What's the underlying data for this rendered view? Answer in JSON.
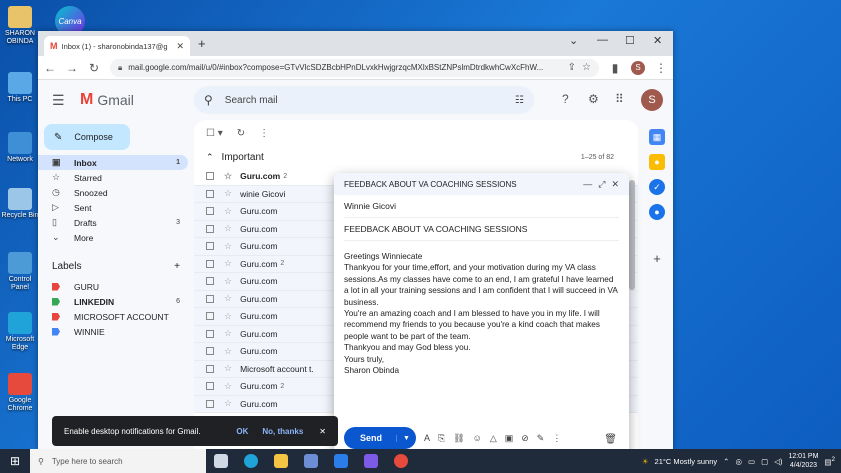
{
  "desktop": {
    "icons": [
      {
        "label": "SHARON OBINDA",
        "color": "#e8c36a"
      },
      {
        "label": "This PC",
        "color": "#5aa9e6"
      },
      {
        "label": "Network",
        "color": "#3f8fd6"
      },
      {
        "label": "Recycle Bin",
        "color": "#9cc6e8"
      },
      {
        "label": "Control Panel",
        "color": "#4c9ad6"
      },
      {
        "label": "Microsoft Edge",
        "color": "#1fa3d8"
      },
      {
        "label": "Google Chrome",
        "color": "#e64a3c"
      }
    ],
    "canva_label": "Canva"
  },
  "browser": {
    "tab_title": "Inbox (1) - sharonobinda137@g",
    "url": "mail.google.com/mail/u/0/#inbox?compose=GTvVlcSDZBcbHPnDLvxkHwjgrzqcMXlxBStZNPslmDtrdkwhCwXcFhW...",
    "profile_initial": "S"
  },
  "gmail": {
    "brand": "Gmail",
    "search_placeholder": "Search mail",
    "compose_label": "Compose",
    "nav": [
      {
        "label": "Inbox",
        "icon": "▣",
        "count": "1",
        "active": true
      },
      {
        "label": "Starred",
        "icon": "☆",
        "count": ""
      },
      {
        "label": "Snoozed",
        "icon": "◷",
        "count": ""
      },
      {
        "label": "Sent",
        "icon": "▷",
        "count": ""
      },
      {
        "label": "Drafts",
        "icon": "▯",
        "count": "3"
      },
      {
        "label": "More",
        "icon": "⌄",
        "count": ""
      }
    ],
    "labels_heading": "Labels",
    "labels": [
      {
        "name": "GURU",
        "color": "#e8453c",
        "count": "",
        "bold": false
      },
      {
        "name": "LINKEDIN",
        "color": "#34a853",
        "count": "6",
        "bold": true
      },
      {
        "name": "MICROSOFT ACCOUNT",
        "color": "#e8453c",
        "count": "",
        "bold": false
      },
      {
        "name": "WINNIE",
        "color": "#4285f4",
        "count": "",
        "bold": false
      }
    ],
    "section_title": "Important",
    "section_count": "1–25 of 82",
    "emails": [
      {
        "sender": "Guru.com",
        "count": "2",
        "unread": true
      },
      {
        "sender": "winie Gicovi",
        "count": "",
        "unread": false
      },
      {
        "sender": "Guru.com",
        "count": "",
        "unread": false
      },
      {
        "sender": "Guru.com",
        "count": "",
        "unread": false
      },
      {
        "sender": "Guru.com",
        "count": "",
        "unread": false
      },
      {
        "sender": "Guru.com",
        "count": "2",
        "unread": false
      },
      {
        "sender": "Guru.com",
        "count": "",
        "unread": false
      },
      {
        "sender": "Guru.com",
        "count": "",
        "unread": false
      },
      {
        "sender": "Guru.com",
        "count": "",
        "unread": false
      },
      {
        "sender": "Guru.com",
        "count": "",
        "unread": false
      },
      {
        "sender": "Guru.com",
        "count": "",
        "unread": false
      },
      {
        "sender": "Microsoft account t.",
        "count": "",
        "unread": false
      },
      {
        "sender": "Guru.com",
        "count": "2",
        "unread": false
      },
      {
        "sender": "Guru.com",
        "count": "",
        "unread": false
      }
    ]
  },
  "compose": {
    "header_title": "FEEDBACK ABOUT VA COACHING SESSIONS",
    "to": "Winnie Gicovi",
    "subject": "FEEDBACK ABOUT VA COACHING SESSIONS",
    "body": [
      "Greetings Winniecate",
      "Thankyou for your time,effort, and your motivation during my VA class sessions.As my classes have come to an end, I am grateful I have learned a lot in all your training sessions and I am confident that I will succeed in VA business.",
      "You're an amazing coach and I am blessed to have you in my life. I will recommend my friends to you because you're a kind coach that makes people want to be part of the team.",
      "Thankyou and may God bless you.",
      "Yours truly,",
      "Sharon Obinda"
    ],
    "send_label": "Send"
  },
  "toast": {
    "message": "Enable desktop notifications for Gmail.",
    "ok": "OK",
    "no_thanks": "No, thanks"
  },
  "taskbar": {
    "search_placeholder": "Type here to search",
    "weather": "21°C  Mostly sunny",
    "time": "12:01 PM",
    "date": "4/4/2023",
    "notif_count": "2"
  }
}
